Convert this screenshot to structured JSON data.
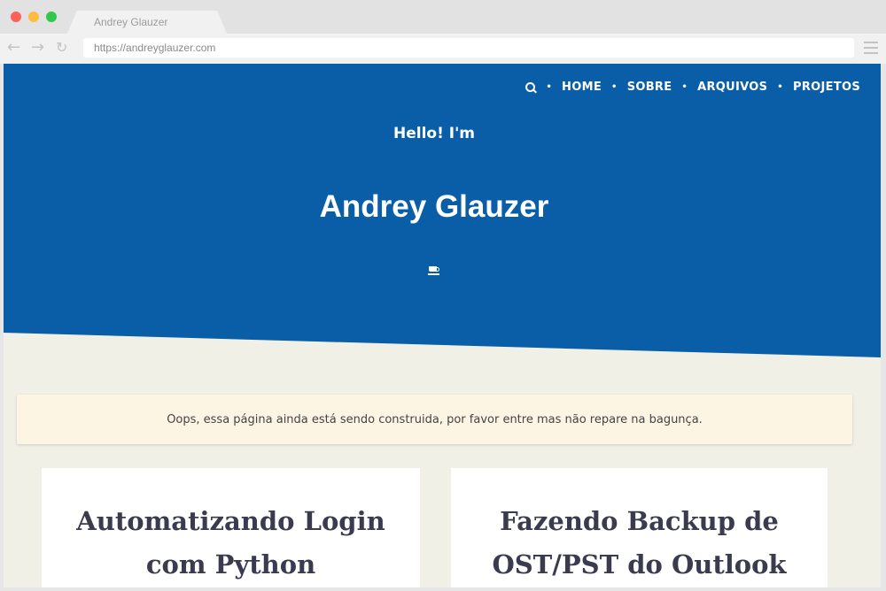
{
  "browser": {
    "tab_title": "Andrey Glauzer",
    "url": "https://andreyglauzer.com",
    "icons": {
      "back": "arrow-left-icon",
      "forward": "arrow-right-icon",
      "reload": "reload-icon",
      "menu": "hamburger-menu-icon"
    }
  },
  "nav": {
    "search_icon": "search-icon",
    "separator": "•",
    "items": [
      "HOME",
      "SOBRE",
      "ARQUIVOS",
      "PROJETOS"
    ]
  },
  "hero": {
    "greeting": "Hello! I'm",
    "name": "Andrey Glauzer",
    "icon": "coffee-icon"
  },
  "notice": {
    "text": "Oops, essa página ainda está sendo construida, por favor entre mas não repare na bagunça."
  },
  "posts": [
    {
      "title": "Automatizando Login com Python"
    },
    {
      "title": "Fazendo Backup de OST/PST do Outlook"
    }
  ],
  "colors": {
    "hero_bg": "#0a5ea8",
    "page_bg": "#f1f0e6",
    "notice_bg": "#fdf5e3",
    "card_title": "#3b3b4f"
  }
}
